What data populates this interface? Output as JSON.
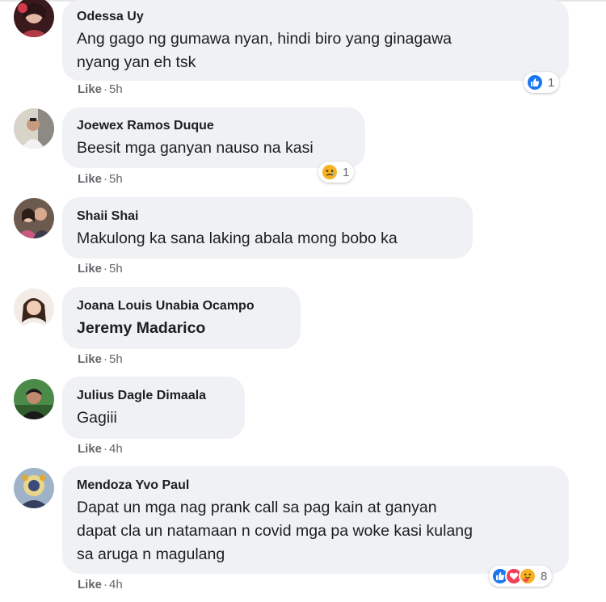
{
  "comments": [
    {
      "author": "Odessa Uy",
      "text_lines": [
        "Ang gago ng gumawa nyan, hindi biro yang ginagawa",
        "nyang yan eh tsk"
      ],
      "like_label": "Like",
      "time": "5h",
      "reactions": {
        "icons": [
          "like-reaction-icon"
        ],
        "count": "1"
      }
    },
    {
      "author": "Joewex Ramos Duque",
      "text_lines": [
        "Beesit mga ganyan nauso na kasi"
      ],
      "like_label": "Like",
      "time": "5h",
      "reactions": {
        "icons": [
          "sad-reaction-icon"
        ],
        "count": "1"
      }
    },
    {
      "author": "Shaii Shai",
      "text_lines": [
        "Makulong ka sana laking abala mong bobo ka"
      ],
      "like_label": "Like",
      "time": "5h"
    },
    {
      "author": "Joana Louis Unabia Ocampo",
      "mention": "Jeremy Madarico",
      "like_label": "Like",
      "time": "5h"
    },
    {
      "author": "Julius Dagle Dimaala",
      "text_lines": [
        "Gagiii"
      ],
      "like_label": "Like",
      "time": "4h"
    },
    {
      "author": "Mendoza Yvo Paul",
      "text_lines": [
        "Dapat un mga nag prank call sa pag kain at ganyan",
        "dapat cla un natamaan n covid mga pa woke kasi kulang",
        "sa aruga n magulang"
      ],
      "like_label": "Like",
      "time": "4h",
      "reactions": {
        "icons": [
          "like-reaction-icon",
          "love-reaction-icon",
          "care-reaction-icon"
        ],
        "count": "8"
      }
    }
  ],
  "colors": {
    "bubble": "#eff1f4",
    "text": "#1c1e21",
    "meta": "#65676b",
    "like_blue": "#1877f2",
    "love_red": "#f33e58",
    "care_yellow": "#f7b125"
  }
}
